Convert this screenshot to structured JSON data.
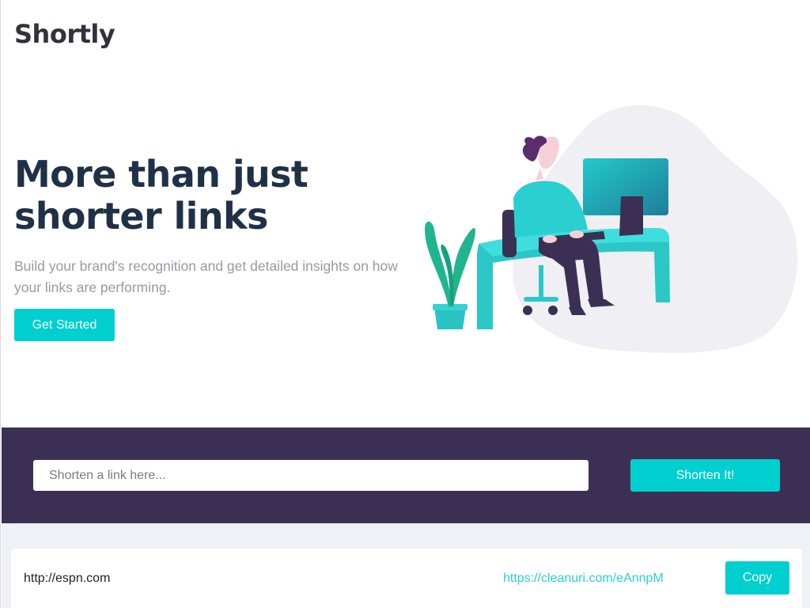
{
  "brand": {
    "logo_text": "Shortly"
  },
  "hero": {
    "title_line1": "More than just",
    "title_line2": "shorter links",
    "subtitle": "Build your brand's recognition and get detailed insights on how your links are performing.",
    "cta_label": "Get Started",
    "illustration_icon": "person-working-illustration"
  },
  "shorten": {
    "input_placeholder": "Shorten a link here...",
    "input_value": "",
    "button_label": "Shorten It!"
  },
  "results": [
    {
      "original": "http://espn.com",
      "short": "https://cleanuri.com/eAnnpM",
      "copy_label": "Copy"
    }
  ],
  "colors": {
    "accent": "#00cfcf",
    "band": "#3b3054",
    "title": "#1f3147",
    "muted": "#9a98a3",
    "results_bg": "#f0f1f6"
  }
}
